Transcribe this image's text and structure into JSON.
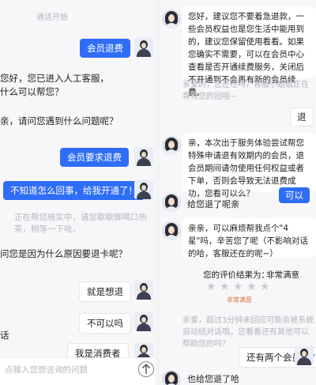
{
  "left": {
    "top_cut": "",
    "session_start": "通话开始",
    "msg_member_refund": "会员退费",
    "agent_intro_line1": "您好，您已进入人工客服，",
    "agent_intro_line2": "什么可以帮您？",
    "agent_q_problem": "亲，请问您遇到什么问题呢？",
    "msg_member_request_refund": "会员要求退费",
    "msg_dont_know": "不知道怎么回事，给我开通了！",
    "agent_checking_line1": "正在帮您核实中，请您歇歇脚喝口热",
    "agent_checking_line2": "茶，稍等一下哈。",
    "agent_q_reason": "问您是因为什么原因要退卡呢？",
    "msg_just_refund": "就是想退",
    "msg_can_it": "不可以吗",
    "agent_fragment": "话",
    "msg_consumer": "我是消费者",
    "input_placeholder": "点输入您想咨询的问题"
  },
  "right": {
    "agent_panel_1": "您好，建议您不要着急退款，一些会员权益也是您生活中能用到的，建议您保留使用看看。如果您确实不需要，可以在会员中心查看是否开通续费服务，关闭后不开通到不会再有新的会员续费。",
    "system_note_1": "亲爱的，您还在吗？客服小姐姐正在等待您的回哦~",
    "msg_return": "退",
    "agent_panel_2": "亲，本次出于服务体验尝试帮您特殊申请退有效期内的会员，退会员期间请勿使用任何权益或者下单，否则会导致无法退费成功，您看可以么？",
    "msg_ok_fragment": "可以",
    "agent_refunded": "给您退了呢亲",
    "agent_panel_3": "亲亲，可以麻烦帮我点个\"4星\"吗，辛苦您了呢（不影响对话的哈，客服还在的呢~）",
    "rating_label": "您的评价结果为：",
    "rating_value": "非常满意",
    "rating_stars": 5,
    "rating_caption": "非常满意",
    "system_note_2": "亲爱，超过3分钟未回应可能会被系统自动结对话哦。您看看还有其他可以帮助您的吗？",
    "msg_two_members": "还有两个会员呢？",
    "agent_also_refunded": "也给您退了哈"
  },
  "colors": {
    "user_bubble": "#2f6df6",
    "agent_bubble": "#ffffff",
    "system_text": "#b5b8bf",
    "star_empty": "#c8cbd1"
  },
  "icons": {
    "send": "up-arrow-icon",
    "user_avatar": "user-avatar-icon",
    "agent_avatar": "agent-avatar-icon"
  }
}
